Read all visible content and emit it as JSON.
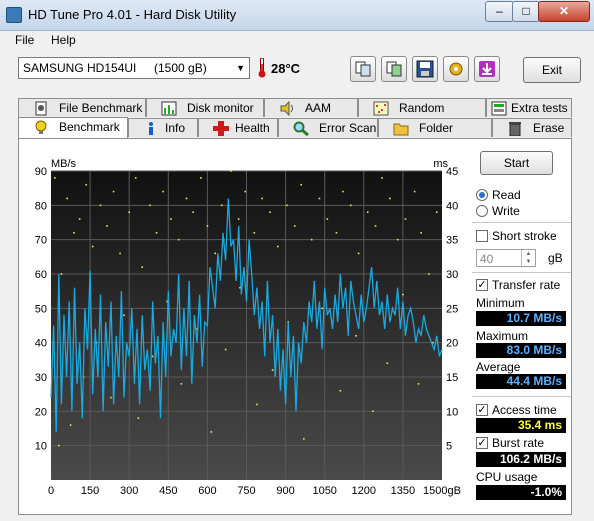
{
  "window": {
    "title": "HD Tune Pro 4.01 - Hard Disk Utility",
    "min": "–",
    "max": "□",
    "close": "✕"
  },
  "menu": [
    "File",
    "Help"
  ],
  "toolbar": {
    "drive_name": "SAMSUNG HD154UI",
    "drive_size": "(1500 gB)",
    "temperature": "28°C",
    "exit_label": "Exit",
    "icons": [
      "copy-text-icon",
      "copy-screenshot-icon",
      "save-icon",
      "options-icon",
      "download-icon"
    ]
  },
  "tabs_top": [
    {
      "label": "File Benchmark",
      "icon": "file-benchmark-icon"
    },
    {
      "label": "Disk monitor",
      "icon": "disk-monitor-icon"
    },
    {
      "label": "AAM",
      "icon": "speaker-icon"
    },
    {
      "label": "Random Access",
      "icon": "random-access-icon"
    },
    {
      "label": "Extra tests",
      "icon": "extra-tests-icon"
    }
  ],
  "tabs_bottom": [
    {
      "label": "Benchmark",
      "icon": "bulb-icon",
      "active": true
    },
    {
      "label": "Info",
      "icon": "info-icon"
    },
    {
      "label": "Health",
      "icon": "health-cross-icon"
    },
    {
      "label": "Error Scan",
      "icon": "magnifier-icon"
    },
    {
      "label": "Folder Usage",
      "icon": "folder-icon"
    },
    {
      "label": "Erase",
      "icon": "trash-icon"
    }
  ],
  "side": {
    "start_label": "Start",
    "read_label": "Read",
    "write_label": "Write",
    "short_stroke_label": "Short stroke",
    "short_stroke_value": "40",
    "short_stroke_unit": "gB",
    "transfer_rate_label": "Transfer rate",
    "minimum_label": "Minimum",
    "minimum_value": "10.7 MB/s",
    "maximum_label": "Maximum",
    "maximum_value": "83.0 MB/s",
    "average_label": "Average",
    "average_value": "44.4 MB/s",
    "access_time_label": "Access time",
    "access_time_value": "35.4 ms",
    "burst_rate_label": "Burst rate",
    "burst_rate_value": "106.2 MB/s",
    "cpu_usage_label": "CPU usage",
    "cpu_usage_value": "-1.0%"
  },
  "colors": {
    "transfer_line": "#1aa9e0",
    "access_points": "#e8e85a",
    "chart_bg_top": "#111111",
    "chart_bg_bottom": "#4a4a4a",
    "grid": "#5a5a5a"
  },
  "chart_data": {
    "type": "line",
    "ylabel_left": "MB/s",
    "ylabel_right": "ms",
    "xlabel_unit": "gB",
    "x_ticks": [
      "0",
      "150",
      "300",
      "450",
      "600",
      "750",
      "900",
      "1050",
      "1200",
      "1350",
      "1500gB"
    ],
    "y_left_ticks": [
      "10",
      "20",
      "30",
      "40",
      "50",
      "60",
      "70",
      "80",
      "90"
    ],
    "y_right_ticks": [
      "5",
      "10",
      "15",
      "20",
      "25",
      "30",
      "35",
      "40",
      "45"
    ],
    "xlim": [
      0,
      1500
    ],
    "ylim_left": [
      0,
      90
    ],
    "ylim_right": [
      0,
      45
    ],
    "series": [
      {
        "name": "Transfer rate",
        "x": [
          0,
          10,
          20,
          30,
          40,
          50,
          60,
          70,
          80,
          90,
          100,
          110,
          120,
          130,
          140,
          150,
          160,
          170,
          180,
          190,
          200,
          210,
          220,
          230,
          240,
          250,
          260,
          270,
          280,
          290,
          300,
          310,
          320,
          330,
          340,
          350,
          360,
          370,
          380,
          390,
          400,
          410,
          420,
          430,
          440,
          450,
          460,
          470,
          480,
          490,
          500,
          510,
          520,
          530,
          540,
          550,
          560,
          570,
          580,
          590,
          600,
          610,
          620,
          630,
          640,
          650,
          660,
          670,
          680,
          690,
          700,
          710,
          720,
          730,
          740,
          750,
          760,
          770,
          780,
          790,
          800,
          810,
          820,
          830,
          840,
          850,
          860,
          870,
          880,
          890,
          900,
          910,
          920,
          930,
          940,
          950,
          960,
          970,
          980,
          990,
          1000,
          1010,
          1020,
          1030,
          1040,
          1050,
          1060,
          1070,
          1080,
          1090,
          1100,
          1110,
          1120,
          1130,
          1140,
          1150,
          1160,
          1170,
          1180,
          1190,
          1200,
          1210,
          1220,
          1230,
          1240,
          1250,
          1260,
          1270,
          1280,
          1290,
          1300,
          1310,
          1320,
          1330,
          1340,
          1350,
          1360,
          1370,
          1380,
          1390,
          1400,
          1410,
          1420,
          1430,
          1440,
          1450,
          1460,
          1470,
          1480,
          1490,
          1500
        ],
        "y": [
          24,
          45,
          14,
          60,
          22,
          48,
          30,
          52,
          20,
          56,
          28,
          40,
          18,
          50,
          38,
          61,
          25,
          44,
          30,
          54,
          20,
          46,
          33,
          52,
          22,
          42,
          30,
          55,
          24,
          40,
          36,
          50,
          28,
          44,
          22,
          48,
          32,
          38,
          26,
          52,
          34,
          42,
          18,
          46,
          30,
          55,
          36,
          44,
          40,
          60,
          32,
          50,
          36,
          58,
          28,
          48,
          40,
          54,
          33,
          46,
          45,
          62,
          56,
          50,
          66,
          58,
          72,
          64,
          82,
          68,
          70,
          58,
          74,
          54,
          62,
          52,
          70,
          60,
          48,
          56,
          44,
          52,
          36,
          58,
          40,
          48,
          30,
          44,
          26,
          38,
          22,
          46,
          30,
          42,
          20,
          40,
          34,
          46,
          40,
          52,
          46,
          58,
          44,
          52,
          38,
          56,
          48,
          50,
          44,
          54,
          46,
          60,
          50,
          56,
          42,
          58,
          52,
          48,
          44,
          54,
          46,
          50,
          56,
          62,
          50,
          58,
          48,
          52,
          44,
          54,
          46,
          50,
          48,
          56,
          44,
          52,
          42,
          48,
          50,
          46,
          40,
          44,
          42,
          48,
          44,
          42,
          40,
          38,
          42,
          36,
          38
        ]
      },
      {
        "name": "Access time",
        "x": [
          15,
          40,
          62,
          88,
          110,
          135,
          160,
          190,
          215,
          240,
          265,
          300,
          325,
          350,
          380,
          405,
          430,
          460,
          490,
          520,
          545,
          575,
          600,
          630,
          655,
          690,
          720,
          745,
          780,
          810,
          840,
          870,
          905,
          935,
          960,
          1000,
          1030,
          1060,
          1095,
          1120,
          1150,
          1180,
          1215,
          1245,
          1270,
          1300,
          1330,
          1360,
          1395,
          1420,
          1450,
          1480,
          30,
          75,
          125,
          175,
          230,
          280,
          335,
          390,
          445,
          500,
          560,
          615,
          670,
          725,
          790,
          850,
          910,
          970,
          1040,
          1110,
          1170,
          1235,
          1290,
          1350,
          1410,
          1465
        ],
        "y": [
          44,
          30,
          41,
          36,
          38,
          43,
          34,
          40,
          37,
          42,
          33,
          39,
          44,
          31,
          40,
          36,
          42,
          38,
          35,
          41,
          39,
          44,
          37,
          33,
          40,
          45,
          38,
          42,
          36,
          41,
          39,
          34,
          40,
          37,
          43,
          35,
          41,
          38,
          36,
          42,
          40,
          33,
          39,
          37,
          44,
          41,
          35,
          38,
          42,
          36,
          30,
          39,
          5,
          8,
          15,
          20,
          12,
          24,
          9,
          18,
          26,
          14,
          22,
          7,
          19,
          28,
          11,
          16,
          23,
          6,
          25,
          13,
          21,
          10,
          17,
          27,
          14,
          20
        ]
      }
    ]
  }
}
